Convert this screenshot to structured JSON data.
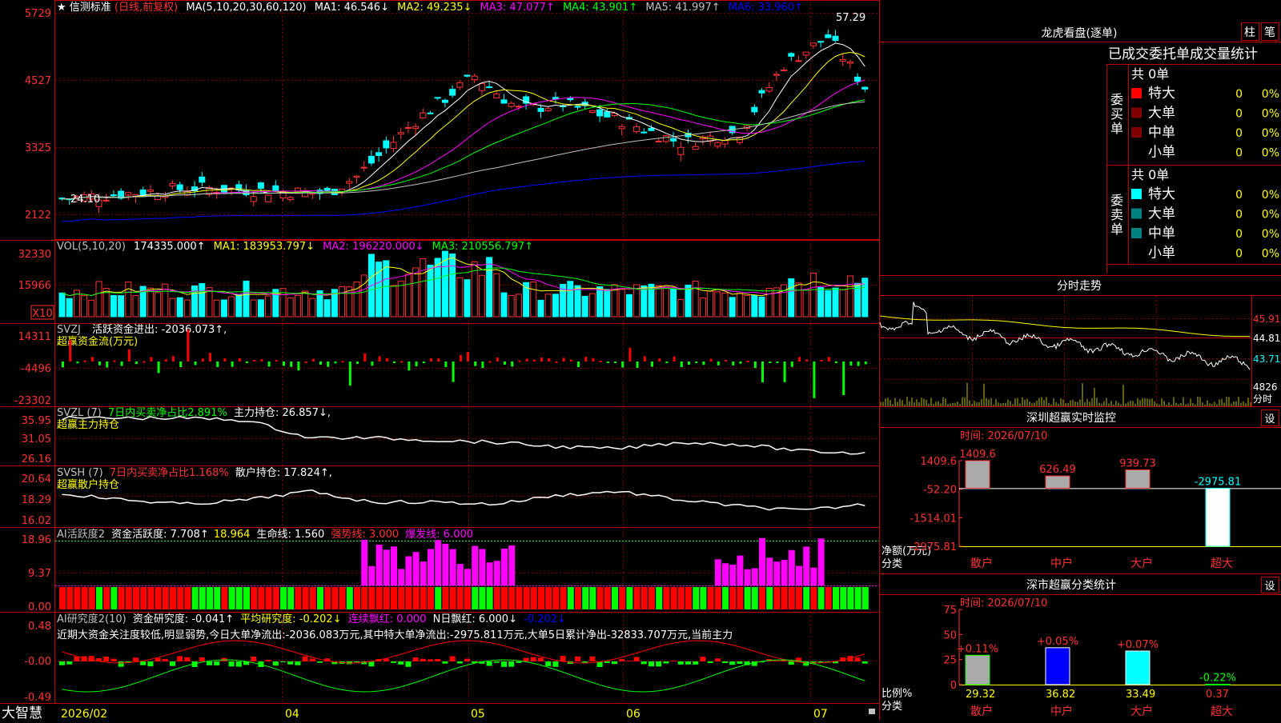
{
  "colors": {
    "up": "#ff3232",
    "down": "#00ffff",
    "ma1": "#ffffff",
    "ma2": "#ffff00",
    "ma3": "#ff00ff",
    "ma4": "#00ff00",
    "ma5": "#c0c0c0",
    "ma6": "#0000ff",
    "grid": "#800000",
    "axis": "#c00000"
  },
  "panels": {
    "price": {
      "title": {
        "star": "★",
        "name": "信测标准",
        "mode": "(日线,前复权)",
        "ma_params": "MA(5,10,20,30,60,120)",
        "ma1": "MA1: 46.546↓",
        "ma2": "MA2: 49.235↓",
        "ma3": "MA3: 47.077↑",
        "ma4": "MA4: 43.901↑",
        "ma5": "MA5: 41.997↑",
        "ma6": "MA6: 33.960↑"
      },
      "yticks": [
        "5729",
        "4527",
        "3325",
        "2122"
      ],
      "high_label": "57.29",
      "low_label": "24.10"
    },
    "vol": {
      "title": {
        "params": "VOL(5,10,20)",
        "value": "174335.000↑",
        "ma1": "MA1: 183953.797↓",
        "ma2": "MA2: 196220.000↓",
        "ma3": "MA3: 210556.797↑"
      },
      "yticks": [
        "32330",
        "15966"
      ],
      "unit": "X10"
    },
    "svzj": {
      "title": {
        "name": "SVZJ",
        "desc": "活跃资金进出: -2036.073↑,",
        "sub": "超赢资金流(万元)"
      },
      "yticks": [
        "14311",
        "-4496",
        "-23302"
      ]
    },
    "svzl": {
      "title": {
        "name": "SVZL (7)",
        "desc": "7日内买卖净占比2.891%",
        "main": "主力持仓: 26.857↓,",
        "sub": "超赢主力持仓"
      },
      "yticks": [
        "35.95",
        "31.05",
        "26.16"
      ]
    },
    "svsh": {
      "title": {
        "name": "SVSH (7)",
        "desc": "7日内买卖净占比1.168%",
        "main": "散户持仓: 17.824↑,",
        "sub": "超赢散户持仓"
      },
      "yticks": [
        "20.64",
        "18.29",
        "16.02"
      ]
    },
    "ai1": {
      "title": {
        "name": "AI活跃度2",
        "a": "资金活跃度: 7.708↑",
        "b": "18.964",
        "c": "生命线: 1.560",
        "d": "强势线: 3.000",
        "e": "爆发线: 6.000"
      },
      "yticks": [
        "18.96",
        "9.37",
        "0.00"
      ]
    },
    "ai2": {
      "title": {
        "name": "AI研究度2(10)",
        "a": "资金研究度: -0.041↑",
        "b": "平均研究度: -0.202↓",
        "c": "连续飘红: 0.000",
        "d": "N日飘红: 6.000↓",
        "e": "-0.202↓"
      },
      "text": "近期大资金关注度较低,明显弱势,今日大单净流出:-2036.083万元,其中特大单净流出:-2975.811万元,大单5日累计净出-32833.707万元,当前主力",
      "yticks": [
        "0.48",
        "-0.00",
        "-0.49"
      ]
    }
  },
  "xaxis": {
    "brand": "大智慧",
    "labels": [
      "2026/02",
      "04",
      "05",
      "06",
      "07"
    ]
  },
  "longhu": {
    "title": "龙虎看盘(逐单)",
    "btn_zhu": "柱",
    "btn_bi": "笔",
    "header": "已成交委托单成交量统计",
    "buy": {
      "label": "委买单",
      "total": "共 0单",
      "rows": [
        {
          "name": "特大",
          "qty": "0",
          "pct": "0%"
        },
        {
          "name": "大单",
          "qty": "0",
          "pct": "0%"
        },
        {
          "name": "中单",
          "qty": "0",
          "pct": "0%"
        },
        {
          "name": "小单",
          "qty": "0",
          "pct": "0%"
        }
      ]
    },
    "sell": {
      "label": "委卖单",
      "total": "共 0单",
      "rows": [
        {
          "name": "特大",
          "qty": "0",
          "pct": "0%"
        },
        {
          "name": "大单",
          "qty": "0",
          "pct": "0%"
        },
        {
          "name": "中单",
          "qty": "0",
          "pct": "0%"
        },
        {
          "name": "小单",
          "qty": "0",
          "pct": "0%"
        }
      ]
    }
  },
  "intraday": {
    "title": "分时走势",
    "yticks": [
      "45.91",
      "44.81",
      "43.71"
    ],
    "vol_tick": "4826",
    "vol_label": "分时"
  },
  "monitor": {
    "title": "深圳超赢实时监控",
    "btn": "设",
    "time": "时间: 2026/07/10",
    "yticks": [
      "1409.6",
      "-52.20",
      "-1514.01",
      "-2975.81"
    ],
    "ylabel": "净额(万元)",
    "xlabel": "分类",
    "cats": [
      "散户",
      "中户",
      "大户",
      "超大"
    ],
    "bar_labels": [
      "1409.6",
      "626.49",
      "939.73",
      "-2975.81"
    ]
  },
  "classify": {
    "title": "深市超赢分类统计",
    "btn": "设",
    "time": "时间: 2026/07/10",
    "yticks": [
      "75",
      "50",
      "25",
      "0"
    ],
    "ylabel": "比例%",
    "xlabel": "分类",
    "cats": [
      "散户",
      "中户",
      "大户",
      "超大"
    ],
    "values": [
      "29.32",
      "36.82",
      "33.49",
      "0.37"
    ],
    "changes": [
      "+0.11%",
      "+0.05%",
      "+0.07%",
      "-0.22%"
    ]
  },
  "chart_data": [
    {
      "type": "bar",
      "title": "深圳超赢实时监控",
      "categories": [
        "散户",
        "中户",
        "大户",
        "超大"
      ],
      "values": [
        1409.6,
        626.49,
        939.73,
        -2975.81
      ],
      "ylabel": "净额(万元)",
      "xlabel": "分类",
      "ylim": [
        -2975.81,
        1409.6
      ]
    },
    {
      "type": "bar",
      "title": "深市超赢分类统计",
      "categories": [
        "散户",
        "中户",
        "大户",
        "超大"
      ],
      "values": [
        29.32,
        36.82,
        33.49,
        0.37
      ],
      "ylabel": "比例%",
      "xlabel": "分类",
      "ylim": [
        0,
        75
      ]
    }
  ]
}
